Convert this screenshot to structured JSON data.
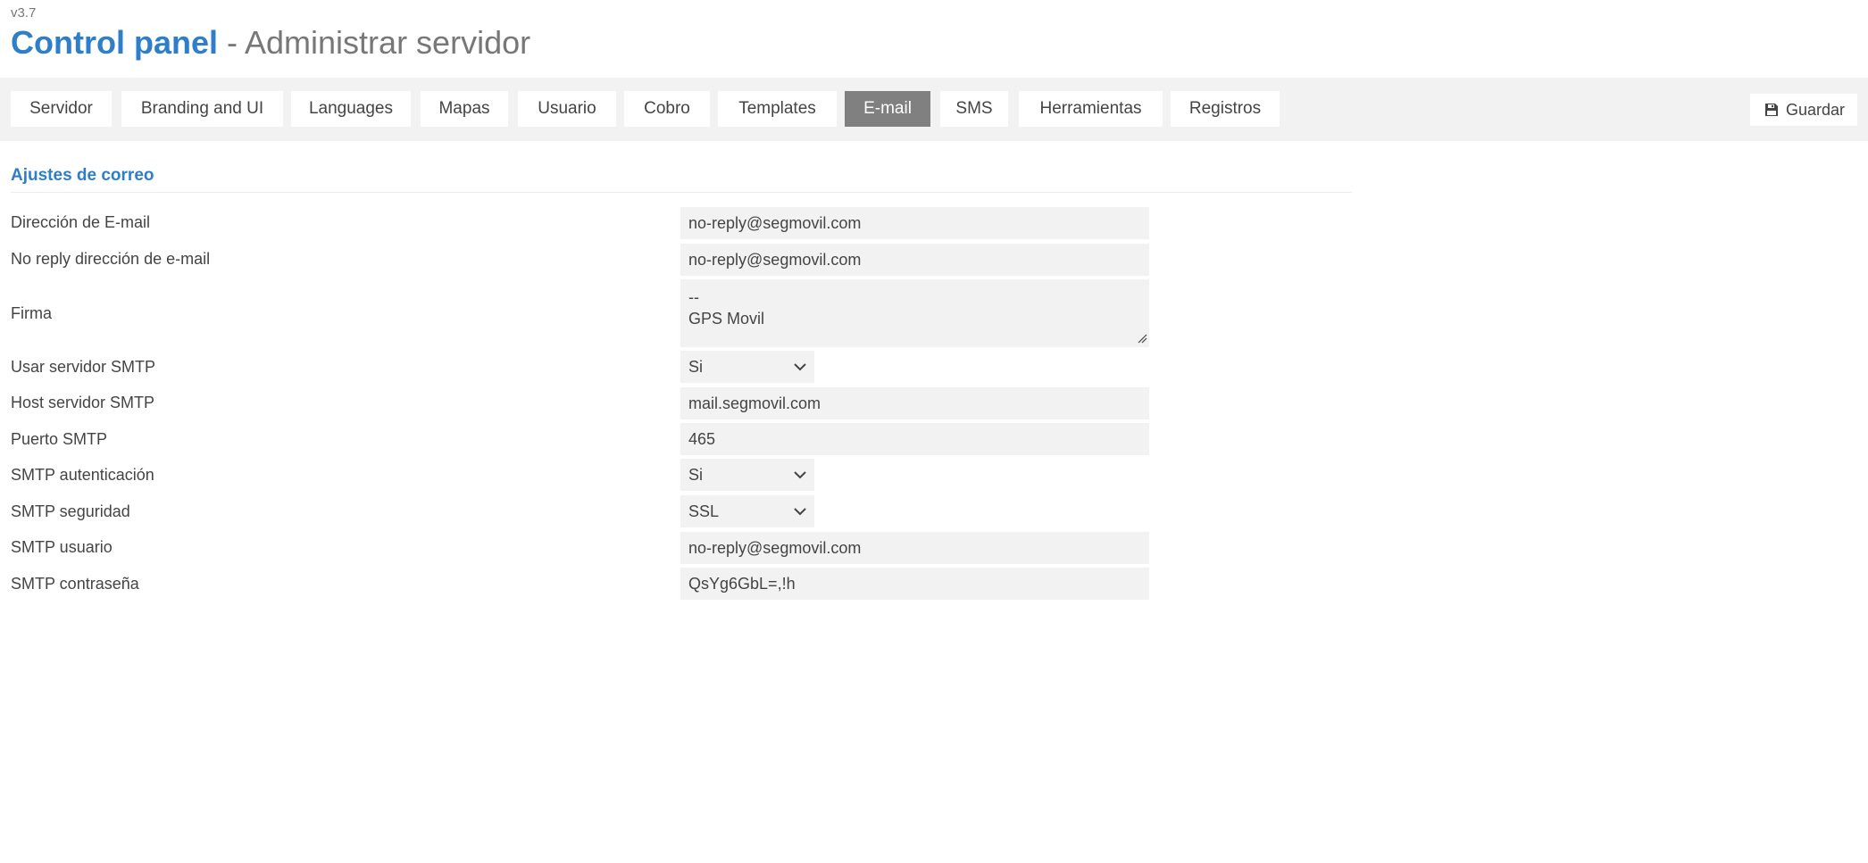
{
  "header": {
    "version": "v3.7",
    "title": "Control panel",
    "separator": " - ",
    "subtitle": "Administrar servidor"
  },
  "tabs": [
    {
      "label": "Servidor",
      "active": false
    },
    {
      "label": "Branding and UI",
      "active": false
    },
    {
      "label": "Languages",
      "active": false
    },
    {
      "label": "Mapas",
      "active": false
    },
    {
      "label": "Usuario",
      "active": false
    },
    {
      "label": "Cobro",
      "active": false
    },
    {
      "label": "Templates",
      "active": false
    },
    {
      "label": "E-mail",
      "active": true
    },
    {
      "label": "SMS",
      "active": false
    },
    {
      "label": "Herramientas",
      "active": false
    },
    {
      "label": "Registros",
      "active": false
    }
  ],
  "toolbar": {
    "save_label": "Guardar",
    "save_icon": "floppy-disk-icon"
  },
  "section": {
    "title": "Ajustes de correo"
  },
  "form": {
    "email_address": {
      "label": "Dirección de E-mail",
      "value": "no-reply@segmovil.com"
    },
    "noreply_address": {
      "label": "No reply dirección de e-mail",
      "value": "no-reply@segmovil.com"
    },
    "signature": {
      "label": "Firma",
      "value": "--\nGPS Movil"
    },
    "use_smtp": {
      "label": "Usar servidor SMTP",
      "value": "Si"
    },
    "smtp_host": {
      "label": "Host servidor SMTP",
      "value": "mail.segmovil.com"
    },
    "smtp_port": {
      "label": "Puerto SMTP",
      "value": "465"
    },
    "smtp_auth": {
      "label": "SMTP autenticación",
      "value": "Si"
    },
    "smtp_security": {
      "label": "SMTP seguridad",
      "value": "SSL"
    },
    "smtp_user": {
      "label": "SMTP usuario",
      "value": "no-reply@segmovil.com"
    },
    "smtp_password": {
      "label": "SMTP contraseña",
      "value": "QsYg6GbL=,!h"
    }
  },
  "colors": {
    "accent": "#2e7ec9",
    "tab_active_bg": "#808080",
    "tabbar_bg": "#f2f2f2",
    "field_bg": "#f2f2f2"
  }
}
